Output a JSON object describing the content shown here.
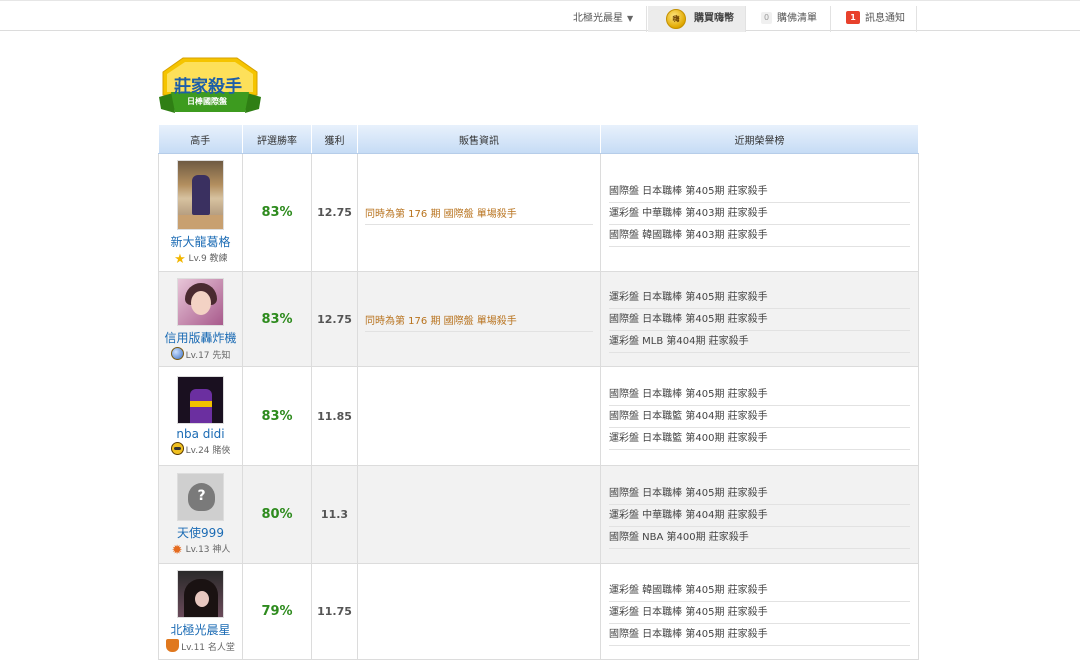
{
  "topbar": {
    "username": "北極光晨星",
    "buy_coin_label": "購買嗨幣",
    "coin_glyph": "嗨",
    "cart_count": "0",
    "cart_label": "購佛清單",
    "msg_count": "1",
    "msg_label": "訊息通知"
  },
  "logo": {
    "title": "莊家殺手",
    "subtitle": "日棒國際盤"
  },
  "table": {
    "headers": [
      "高手",
      "評選勝率",
      "獲利",
      "販售資訊",
      "近期榮譽榜"
    ],
    "rows": [
      {
        "name": "新大龍葛格",
        "level": "Lv.9 教練",
        "rate": "83%",
        "profit": "12.75",
        "sale": "同時為第 176 期 國際盤 單場殺手",
        "honors": [
          "國際盤 日本職棒 第405期 莊家殺手",
          "運彩盤 中華職棒 第403期 莊家殺手",
          "國際盤 韓國職棒 第403期 莊家殺手"
        ]
      },
      {
        "name": "信用版轟炸機",
        "level": "Lv.17 先知",
        "rate": "83%",
        "profit": "12.75",
        "sale": "同時為第 176 期 國際盤 單場殺手",
        "honors": [
          "運彩盤 日本職棒 第405期 莊家殺手",
          "國際盤 日本職棒 第405期 莊家殺手",
          "運彩盤 MLB 第404期 莊家殺手"
        ]
      },
      {
        "name": "nba didi",
        "level": "Lv.24 賭俠",
        "rate": "83%",
        "profit": "11.85",
        "sale": "",
        "honors": [
          "國際盤 日本職棒 第405期 莊家殺手",
          "國際盤 日本職籃 第404期 莊家殺手",
          "運彩盤 日本職籃 第400期 莊家殺手"
        ]
      },
      {
        "name": "天使999",
        "level": "Lv.13 神人",
        "rate": "80%",
        "profit": "11.3",
        "sale": "",
        "honors": [
          "國際盤 日本職棒 第405期 莊家殺手",
          "運彩盤 中華職棒 第404期 莊家殺手",
          "國際盤 NBA 第400期 莊家殺手"
        ]
      },
      {
        "name": "北極光晨星",
        "level": "Lv.11 名人堂",
        "rate": "79%",
        "profit": "11.75",
        "sale": "",
        "honors": [
          "運彩盤 韓國職棒 第405期 莊家殺手",
          "運彩盤 日本職棒 第405期 莊家殺手",
          "國際盤 日本職棒 第405期 莊家殺手"
        ]
      }
    ]
  },
  "colors": {
    "rate_green": "#2e8b1e",
    "sale_orange": "#b8731e",
    "name_blue": "#1b6bb4",
    "header_blue": "#c6dcf5",
    "logo_gold": "#f5c400",
    "logo_green": "#3d9b1f"
  },
  "icons": {
    "coin": "coin-icon",
    "lv_row1": "star-icon",
    "lv_row2": "moon-icon",
    "lv_row3": "dice-icon",
    "lv_row4": "sun-icon",
    "lv_row5": "shield-icon"
  }
}
